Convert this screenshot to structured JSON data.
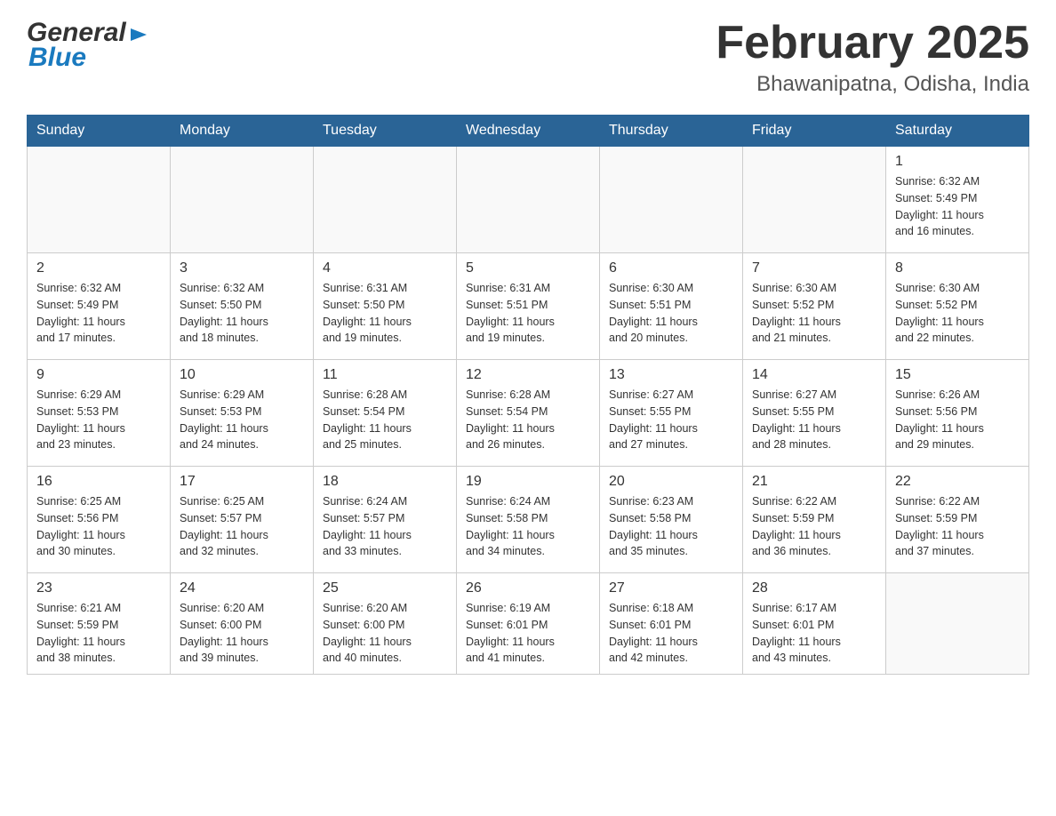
{
  "header": {
    "logo_general": "General",
    "logo_blue": "Blue",
    "month_title": "February 2025",
    "location": "Bhawanipatna, Odisha, India"
  },
  "days_of_week": [
    "Sunday",
    "Monday",
    "Tuesday",
    "Wednesday",
    "Thursday",
    "Friday",
    "Saturday"
  ],
  "weeks": [
    {
      "days": [
        {
          "number": "",
          "info": ""
        },
        {
          "number": "",
          "info": ""
        },
        {
          "number": "",
          "info": ""
        },
        {
          "number": "",
          "info": ""
        },
        {
          "number": "",
          "info": ""
        },
        {
          "number": "",
          "info": ""
        },
        {
          "number": "1",
          "info": "Sunrise: 6:32 AM\nSunset: 5:49 PM\nDaylight: 11 hours\nand 16 minutes."
        }
      ]
    },
    {
      "days": [
        {
          "number": "2",
          "info": "Sunrise: 6:32 AM\nSunset: 5:49 PM\nDaylight: 11 hours\nand 17 minutes."
        },
        {
          "number": "3",
          "info": "Sunrise: 6:32 AM\nSunset: 5:50 PM\nDaylight: 11 hours\nand 18 minutes."
        },
        {
          "number": "4",
          "info": "Sunrise: 6:31 AM\nSunset: 5:50 PM\nDaylight: 11 hours\nand 19 minutes."
        },
        {
          "number": "5",
          "info": "Sunrise: 6:31 AM\nSunset: 5:51 PM\nDaylight: 11 hours\nand 19 minutes."
        },
        {
          "number": "6",
          "info": "Sunrise: 6:30 AM\nSunset: 5:51 PM\nDaylight: 11 hours\nand 20 minutes."
        },
        {
          "number": "7",
          "info": "Sunrise: 6:30 AM\nSunset: 5:52 PM\nDaylight: 11 hours\nand 21 minutes."
        },
        {
          "number": "8",
          "info": "Sunrise: 6:30 AM\nSunset: 5:52 PM\nDaylight: 11 hours\nand 22 minutes."
        }
      ]
    },
    {
      "days": [
        {
          "number": "9",
          "info": "Sunrise: 6:29 AM\nSunset: 5:53 PM\nDaylight: 11 hours\nand 23 minutes."
        },
        {
          "number": "10",
          "info": "Sunrise: 6:29 AM\nSunset: 5:53 PM\nDaylight: 11 hours\nand 24 minutes."
        },
        {
          "number": "11",
          "info": "Sunrise: 6:28 AM\nSunset: 5:54 PM\nDaylight: 11 hours\nand 25 minutes."
        },
        {
          "number": "12",
          "info": "Sunrise: 6:28 AM\nSunset: 5:54 PM\nDaylight: 11 hours\nand 26 minutes."
        },
        {
          "number": "13",
          "info": "Sunrise: 6:27 AM\nSunset: 5:55 PM\nDaylight: 11 hours\nand 27 minutes."
        },
        {
          "number": "14",
          "info": "Sunrise: 6:27 AM\nSunset: 5:55 PM\nDaylight: 11 hours\nand 28 minutes."
        },
        {
          "number": "15",
          "info": "Sunrise: 6:26 AM\nSunset: 5:56 PM\nDaylight: 11 hours\nand 29 minutes."
        }
      ]
    },
    {
      "days": [
        {
          "number": "16",
          "info": "Sunrise: 6:25 AM\nSunset: 5:56 PM\nDaylight: 11 hours\nand 30 minutes."
        },
        {
          "number": "17",
          "info": "Sunrise: 6:25 AM\nSunset: 5:57 PM\nDaylight: 11 hours\nand 32 minutes."
        },
        {
          "number": "18",
          "info": "Sunrise: 6:24 AM\nSunset: 5:57 PM\nDaylight: 11 hours\nand 33 minutes."
        },
        {
          "number": "19",
          "info": "Sunrise: 6:24 AM\nSunset: 5:58 PM\nDaylight: 11 hours\nand 34 minutes."
        },
        {
          "number": "20",
          "info": "Sunrise: 6:23 AM\nSunset: 5:58 PM\nDaylight: 11 hours\nand 35 minutes."
        },
        {
          "number": "21",
          "info": "Sunrise: 6:22 AM\nSunset: 5:59 PM\nDaylight: 11 hours\nand 36 minutes."
        },
        {
          "number": "22",
          "info": "Sunrise: 6:22 AM\nSunset: 5:59 PM\nDaylight: 11 hours\nand 37 minutes."
        }
      ]
    },
    {
      "days": [
        {
          "number": "23",
          "info": "Sunrise: 6:21 AM\nSunset: 5:59 PM\nDaylight: 11 hours\nand 38 minutes."
        },
        {
          "number": "24",
          "info": "Sunrise: 6:20 AM\nSunset: 6:00 PM\nDaylight: 11 hours\nand 39 minutes."
        },
        {
          "number": "25",
          "info": "Sunrise: 6:20 AM\nSunset: 6:00 PM\nDaylight: 11 hours\nand 40 minutes."
        },
        {
          "number": "26",
          "info": "Sunrise: 6:19 AM\nSunset: 6:01 PM\nDaylight: 11 hours\nand 41 minutes."
        },
        {
          "number": "27",
          "info": "Sunrise: 6:18 AM\nSunset: 6:01 PM\nDaylight: 11 hours\nand 42 minutes."
        },
        {
          "number": "28",
          "info": "Sunrise: 6:17 AM\nSunset: 6:01 PM\nDaylight: 11 hours\nand 43 minutes."
        },
        {
          "number": "",
          "info": ""
        }
      ]
    }
  ]
}
